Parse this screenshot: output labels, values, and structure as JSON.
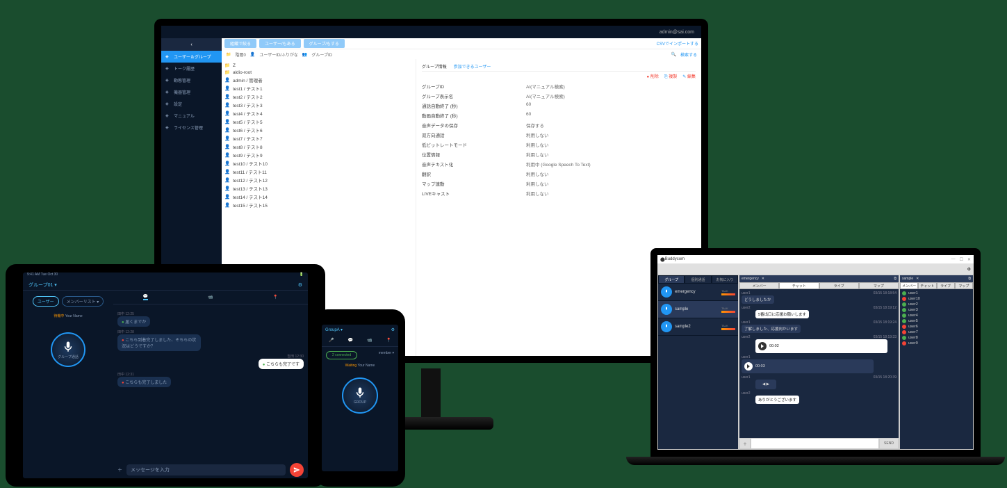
{
  "monitor": {
    "account": "admin@sai.com",
    "sidebar": [
      {
        "icon": "users",
        "label": "ユーザー＆グループ",
        "active": true
      },
      {
        "icon": "chat",
        "label": "トーク履歴"
      },
      {
        "icon": "pin",
        "label": "動態管理"
      },
      {
        "icon": "link",
        "label": "機器管理"
      },
      {
        "icon": "gear",
        "label": "設定"
      },
      {
        "icon": "book",
        "label": "マニュアル"
      },
      {
        "icon": "key",
        "label": "ライセンス管理"
      }
    ],
    "tabs": [
      "組織で絞る",
      "ユーザー/もある",
      "グループ/もする"
    ],
    "breadcrumb": {
      "root": "階層0",
      "path": "ユーザーID/ふりがな",
      "group": "グループID"
    },
    "search_label": "検索する",
    "csv_label": "CSVでインポートする",
    "tree": [
      {
        "type": "folder",
        "label": "Z"
      },
      {
        "type": "folder",
        "label": "aldio-root"
      },
      {
        "type": "user",
        "label": "admin / 管理者"
      },
      {
        "type": "user",
        "label": "test1 / テスト1"
      },
      {
        "type": "user",
        "label": "test2 / テスト2"
      },
      {
        "type": "user",
        "label": "test3 / テスト3"
      },
      {
        "type": "user",
        "label": "test4 / テスト4"
      },
      {
        "type": "user",
        "label": "test5 / テスト5"
      },
      {
        "type": "user",
        "label": "test6 / テスト6"
      },
      {
        "type": "user",
        "label": "test7 / テスト7"
      },
      {
        "type": "user",
        "label": "test8 / テスト8"
      },
      {
        "type": "user",
        "label": "test9 / テスト9"
      },
      {
        "type": "user",
        "label": "test10 / テスト10"
      },
      {
        "type": "user",
        "label": "test11 / テスト11"
      },
      {
        "type": "user",
        "label": "test12 / テスト12"
      },
      {
        "type": "user",
        "label": "test13 / テスト13"
      },
      {
        "type": "user",
        "label": "test14 / テスト14"
      },
      {
        "type": "user",
        "label": "test15 / テスト15"
      }
    ],
    "detail_tabs": [
      "グループ情報",
      "参加できるユーザー"
    ],
    "actions": {
      "delete": "削除",
      "copy": "複製",
      "edit": "編集"
    },
    "details": [
      {
        "label": "グループID",
        "value": "AI(マニュアル検索)"
      },
      {
        "label": "グループ表示名",
        "value": "AI(マニュアル検索)"
      },
      {
        "label": "通話自動終了 (秒)",
        "value": "60"
      },
      {
        "label": "動画自動終了 (秒)",
        "value": "60"
      },
      {
        "label": "音声データの保存",
        "value": "保存する"
      },
      {
        "label": "双方向通話",
        "value": "利用しない"
      },
      {
        "label": "低ビットレートモード",
        "value": "利用しない"
      },
      {
        "label": "位置情報",
        "value": "利用しない"
      },
      {
        "label": "音声テキスト化",
        "value": "利用中 (Google Speech To Text)"
      },
      {
        "label": "翻訳",
        "value": "利用しない"
      },
      {
        "label": "マップ連動",
        "value": "利用しない"
      },
      {
        "label": "LIVEキャスト",
        "value": "利用しない"
      }
    ]
  },
  "tablet": {
    "status_time": "9:41 AM  Tue Oct 30",
    "group_title": "グループ01 ▾",
    "left_tabs": [
      "ユーザー",
      "メンバーリスト ▾"
    ],
    "waiting": "待機中",
    "your_name": "Your Name",
    "mic_label": "グループ通話",
    "right_tabs": [
      {
        "icon": "chat",
        "label": ""
      },
      {
        "icon": "video",
        "label": ""
      },
      {
        "icon": "map",
        "label": ""
      }
    ],
    "chat": [
      {
        "side": "left",
        "meta": "田中 12:25",
        "dot": "green",
        "text": "届くまでか"
      },
      {
        "side": "left",
        "meta": "田中 12:28",
        "dot": "red",
        "text": "こちら到着完了しました、そちらの状況はどうですか？"
      },
      {
        "side": "right",
        "meta": "吉田 12:30",
        "dot": "green",
        "text": "こちらも完了です"
      },
      {
        "side": "left",
        "meta": "田中 12:31",
        "dot": "red",
        "text": "こちらも完了しました"
      }
    ],
    "input_placeholder": "メッセージを入力"
  },
  "phone": {
    "group": "GroupA ▾",
    "status": "2 connected",
    "member": "member ▾",
    "waiting": "Waiting",
    "your_name": "Your Name",
    "mic_label": "GROUP"
  },
  "laptop": {
    "title": "Buddycom",
    "group_tabs": [
      "グループ",
      "個別通話",
      "お気に入り"
    ],
    "groups": [
      {
        "name": "emergency",
        "talk": "TALK",
        "active": false
      },
      {
        "name": "sample",
        "talk": "TALK",
        "active": true
      },
      {
        "name": "sample2",
        "talk": "TALK",
        "active": false
      }
    ],
    "mid_title": "emergency",
    "mid_tabs": [
      "メンバー",
      "チャット",
      "ライブ",
      "マップ"
    ],
    "chat": [
      {
        "user": "user1",
        "time": "03/15 18:18:54",
        "text": "どうしましたか",
        "type": "dark"
      },
      {
        "user": "user2",
        "time": "03/15 18:19:12",
        "text": "5番出口に応援お願いします",
        "type": "light"
      },
      {
        "user": "user1",
        "time": "03/15 18:19:24",
        "text": "了解しました、応援向かいます",
        "type": "dark"
      },
      {
        "user": "user2",
        "time": "03/15 18:19:33",
        "text": "00:02",
        "type": "audio-light"
      },
      {
        "user": "user1",
        "time": "",
        "text": "00:03",
        "type": "audio-dark"
      },
      {
        "user": "user1",
        "time": "03/15 18:20:39",
        "text": "",
        "type": "video"
      },
      {
        "user": "user2",
        "time": "",
        "text": "ありがとうございます",
        "type": "light"
      }
    ],
    "send": "SEND",
    "right_title": "sample",
    "right_tabs": [
      "メンバー",
      "チャット",
      "ライブ",
      "マップ"
    ],
    "users": [
      {
        "name": "user1",
        "status": "green"
      },
      {
        "name": "user10",
        "status": "red"
      },
      {
        "name": "user2",
        "status": "green"
      },
      {
        "name": "user3",
        "status": "green"
      },
      {
        "name": "user4",
        "status": "green"
      },
      {
        "name": "user5",
        "status": "green"
      },
      {
        "name": "user6",
        "status": "red"
      },
      {
        "name": "user7",
        "status": "red"
      },
      {
        "name": "user8",
        "status": "green"
      },
      {
        "name": "user9",
        "status": "red"
      }
    ]
  }
}
